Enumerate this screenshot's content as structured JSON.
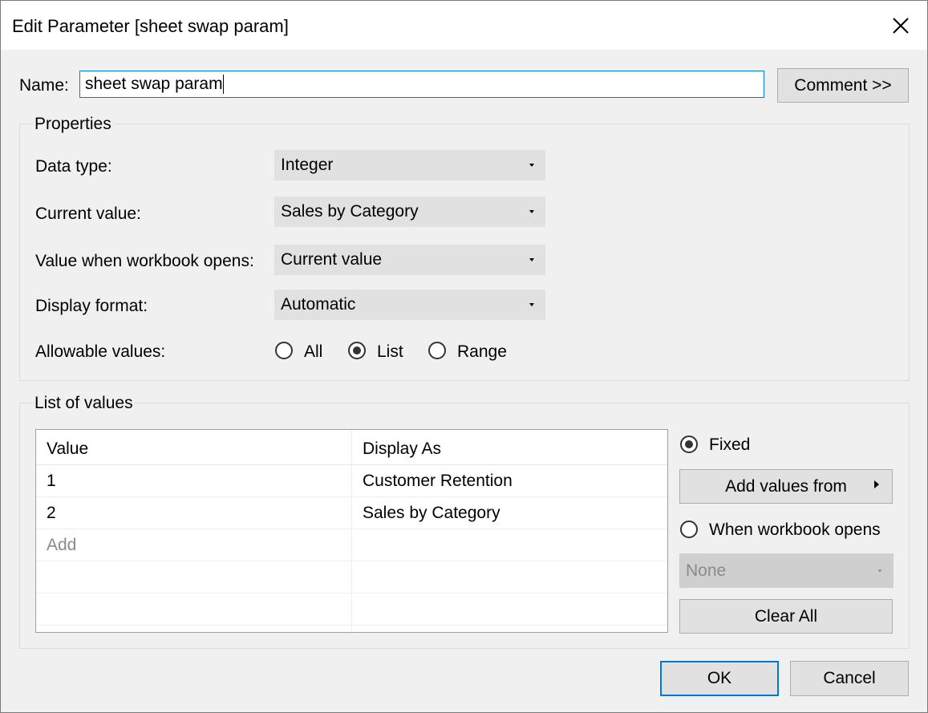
{
  "window": {
    "title": "Edit Parameter [sheet swap param]"
  },
  "name": {
    "label": "Name:",
    "value": "sheet swap param",
    "comment_button": "Comment >>"
  },
  "properties": {
    "group_title": "Properties",
    "data_type": {
      "label": "Data type:",
      "value": "Integer"
    },
    "current_value": {
      "label": "Current value:",
      "value": "Sales by Category"
    },
    "value_when_opens": {
      "label": "Value when workbook opens:",
      "value": "Current value"
    },
    "display_format": {
      "label": "Display format:",
      "value": "Automatic"
    },
    "allowable_values": {
      "label": "Allowable values:",
      "options": [
        "All",
        "List",
        "Range"
      ],
      "selected": "List"
    }
  },
  "list_of_values": {
    "group_title": "List of values",
    "columns": [
      "Value",
      "Display As"
    ],
    "rows": [
      {
        "value": "1",
        "display": "Customer Retention"
      },
      {
        "value": "2",
        "display": "Sales by Category"
      }
    ],
    "add_placeholder": "Add",
    "fixed_label": "Fixed",
    "add_values_from": "Add values from",
    "when_opens_label": "When workbook opens",
    "when_opens_select": "None",
    "clear_all": "Clear All",
    "source_selected": "Fixed"
  },
  "footer": {
    "ok": "OK",
    "cancel": "Cancel"
  }
}
